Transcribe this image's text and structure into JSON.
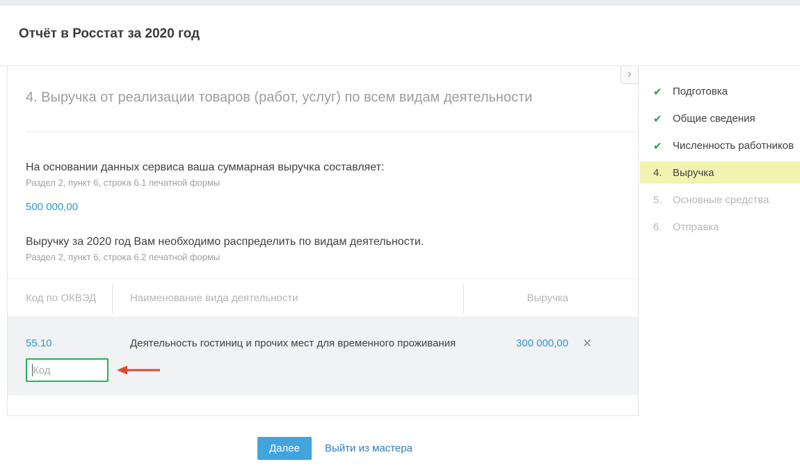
{
  "page": {
    "title": "Отчёт в Росстат за 2020 год"
  },
  "wizard": {
    "section_title": "4. Выручка от реализации товаров (работ, услуг) по всем видам деятельности",
    "summary": {
      "text": "На основании данных сервиса ваша суммарная выручка составляет:",
      "hint": "Раздел 2, пункт 6, строка 6.1 печатной формы",
      "value": "500 000,00"
    },
    "distribute": {
      "text": "Выручку за 2020 год Вам необходимо распределить по видам деятельности.",
      "hint": "Раздел 2, пункт 6, строка 6.2 печатной формы"
    },
    "table": {
      "headers": [
        "Код по ОКВЭД",
        "Наименование вида деятельности",
        "Выручка"
      ],
      "rows": [
        {
          "code": "55.10",
          "name": "Деятельность гостиниц и прочих мест для временного проживания",
          "revenue": "300 000,00"
        }
      ],
      "new_row": {
        "code_placeholder": "Код"
      }
    }
  },
  "steps": {
    "items": [
      {
        "label": "Подготовка",
        "state": "done"
      },
      {
        "label": "Общие сведения",
        "state": "done"
      },
      {
        "label": "Численность работников",
        "state": "done"
      },
      {
        "number": "4.",
        "label": "Выручка",
        "state": "active"
      },
      {
        "number": "5.",
        "label": "Основные средства",
        "state": "pending"
      },
      {
        "number": "6.",
        "label": "Отправка",
        "state": "pending"
      }
    ]
  },
  "footer": {
    "next_label": "Далее",
    "exit_label": "Выйти из мастера"
  },
  "icons": {
    "collapse": "›",
    "check": "✔",
    "delete": "✕"
  },
  "colors": {
    "check_green": "#1e9e4d",
    "active_step_yellow": "#f4f4b2",
    "value_blue": "#2f96d0",
    "link_blue": "#2e7dc0",
    "button_blue": "#41a4dd",
    "input_border_green": "#1db45a",
    "arrow_red": "#dc4937",
    "table_gray_bg": "#f1f2f3",
    "topbar_gray": "#e9edf2"
  }
}
